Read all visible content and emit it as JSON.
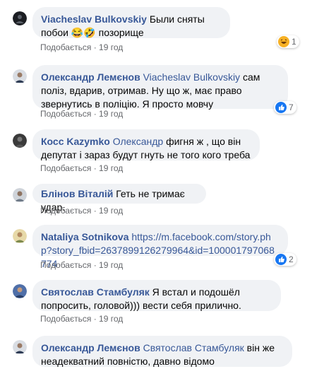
{
  "comments": [
    {
      "author": "Viacheslav Bulkovskiy",
      "mention": "",
      "text": "Были сняты побои 😂🤣 позорище",
      "like_label": "Подобається",
      "time": "19 год",
      "reaction": "haha-icon",
      "reaction_count": "1"
    },
    {
      "author": "Олександр Лемєнов",
      "mention": "Viacheslav Bulkovskiy",
      "text": "сам поліз, вдарив, отримав. Ну що ж, має право звернутись в поліцію. Я просто мовчу",
      "like_label": "Подобається",
      "time": "19 год",
      "reaction": "like-icon",
      "reaction_count": "7"
    },
    {
      "author": "Косс Kazymko",
      "mention": "Олександр",
      "text": "фигня ж , що він депутат і зараз будут гнуть не того кого треба",
      "like_label": "Подобається",
      "time": "19 год",
      "reaction": "",
      "reaction_count": ""
    },
    {
      "author": "Блінов Віталій",
      "mention": "",
      "text": "Геть не тримає удар.",
      "like_label": "Подобається",
      "time": "19 год",
      "reaction": "",
      "reaction_count": ""
    },
    {
      "author": "Nataliya Sotnikova",
      "mention": "",
      "text": "https://m.facebook.com/story.php?story_fbid=2637899126279964&id=100001797068774",
      "like_label": "Подобається",
      "time": "19 год",
      "reaction": "like-icon",
      "reaction_count": "2"
    },
    {
      "author": "Святослав Стамбуляк",
      "mention": "",
      "text": "Я встал и подошёл попросить, головой))) вести себя прилично.",
      "like_label": "Подобається",
      "time": "19 год",
      "reaction": "",
      "reaction_count": ""
    },
    {
      "author": "Олександр Лемєнов",
      "mention": "Святослав Стамбуляк",
      "text": "він же неадекватний повністю, давно відомо",
      "like_label": "Подобається",
      "time": "",
      "reaction": "",
      "reaction_count": ""
    }
  ],
  "colors": {
    "author": "#385898",
    "bubble": "#f0f2f5",
    "meta": "#65676b"
  }
}
